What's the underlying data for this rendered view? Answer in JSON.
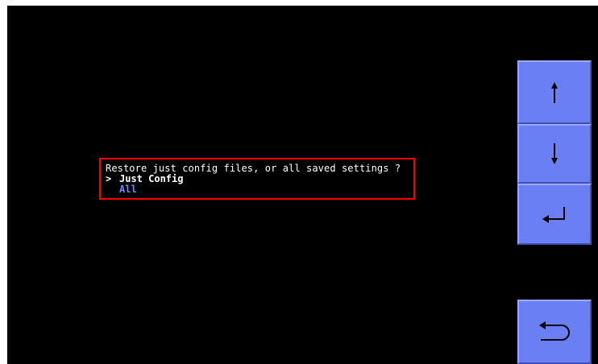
{
  "dialog": {
    "prompt": "Restore just config files, or all saved settings ?",
    "selection_marker": ">",
    "options": [
      {
        "label": "Just Config",
        "selected": true
      },
      {
        "label": "All",
        "selected": false
      }
    ]
  },
  "buttons": [
    {
      "icon": "arrow-up-icon"
    },
    {
      "icon": "arrow-down-icon"
    },
    {
      "icon": "enter-icon"
    },
    {
      "icon": "back-icon"
    }
  ],
  "colors": {
    "background": "#000000",
    "highlight_border": "#ff0000",
    "button_fill": "#6b7ff5",
    "unselected_option": "#8080ff",
    "text": "#ffffff"
  }
}
